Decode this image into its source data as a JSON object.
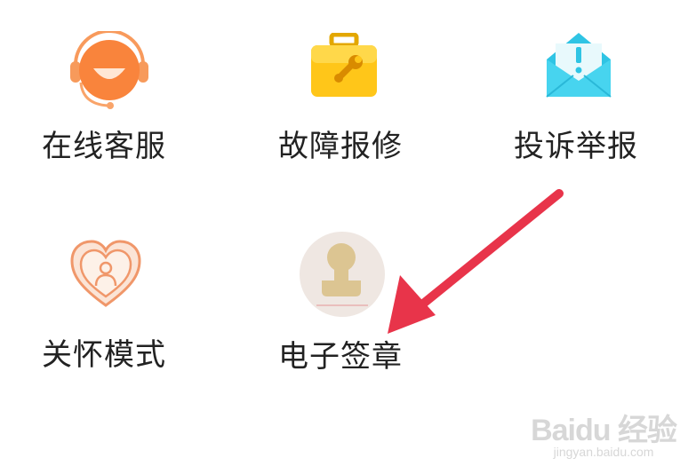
{
  "menu": {
    "items": [
      {
        "label": "在线客服",
        "icon": "customer-service-headset-icon",
        "color": "#f9843c"
      },
      {
        "label": "故障报修",
        "icon": "repair-toolbox-icon",
        "color": "#ffc107"
      },
      {
        "label": "投诉举报",
        "icon": "complaint-envelope-icon",
        "color": "#3fd0ea"
      },
      {
        "label": "关怀模式",
        "icon": "care-heart-person-icon",
        "color": "#f0976a"
      },
      {
        "label": "电子签章",
        "icon": "electronic-seal-stamp-icon",
        "color": "#d9c08c"
      }
    ]
  },
  "annotation": {
    "arrow_color": "#e8344a"
  },
  "watermark": {
    "logo": "Baidu 经验",
    "site": "jingyan.baidu.com"
  }
}
